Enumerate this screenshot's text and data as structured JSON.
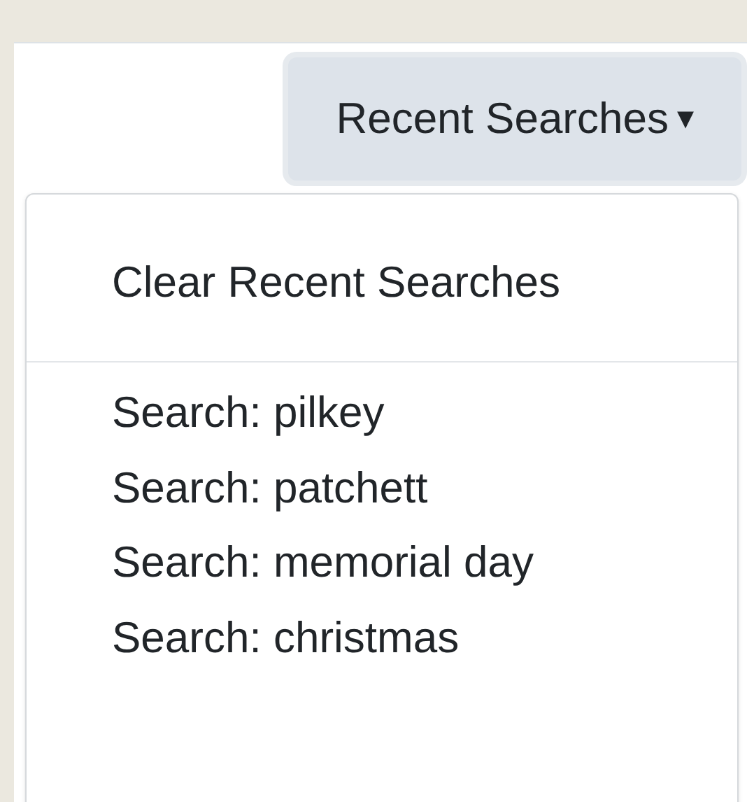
{
  "button": {
    "label": "Recent Searches",
    "caret": "▾",
    "expanded": true
  },
  "menu": {
    "header_action": "Clear Recent Searches",
    "items": [
      "Search: pilkey",
      "Search: patchett",
      "Search: memorial day",
      "Search: christmas"
    ]
  }
}
